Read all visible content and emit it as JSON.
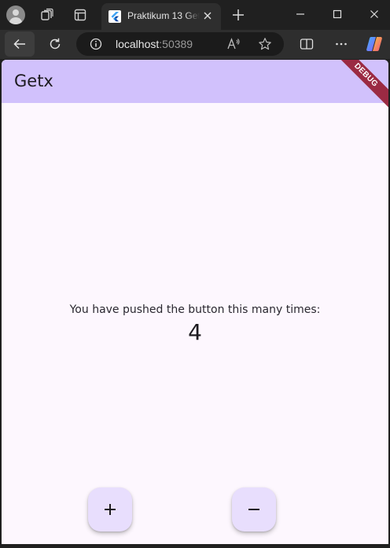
{
  "browser": {
    "tab_title": "Praktikum 13 Getx",
    "url_host": "localhost",
    "url_port": ":50389"
  },
  "app": {
    "appbar_title": "Getx",
    "debug_banner": "DEBUG",
    "counter_label": "You have pushed the button this many times:",
    "counter_value": "4"
  },
  "colors": {
    "appbar": "#d1c1fc",
    "page_background": "#fdf7fe",
    "fab": "#e8defd",
    "debug_banner": "#9b2a43"
  },
  "icons": {
    "increment": "plus-icon",
    "decrement": "minus-icon"
  }
}
